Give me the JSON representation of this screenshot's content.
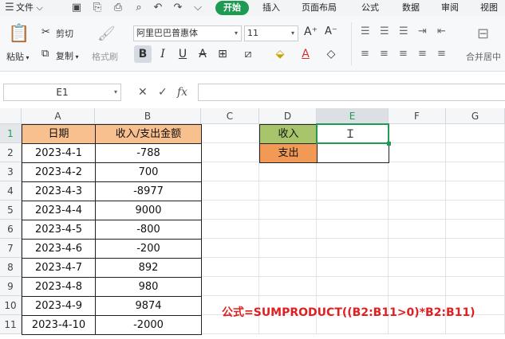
{
  "menubar": {
    "file_label": "文件",
    "tabs": [
      "开始",
      "插入",
      "页面布局",
      "公式",
      "数据",
      "审阅",
      "视图"
    ]
  },
  "ribbon": {
    "paste_label": "粘贴",
    "cut_label": "剪切",
    "copy_label": "复制",
    "format_painter_label": "格式刷",
    "font_name": "阿里巴巴普惠体",
    "font_size": "11",
    "merge_label": "合并居中"
  },
  "formula_bar": {
    "name_box": "E1",
    "formula": ""
  },
  "columns": [
    "A",
    "B",
    "C",
    "D",
    "E",
    "F",
    "G"
  ],
  "rows": [
    "1",
    "2",
    "3",
    "4",
    "5",
    "6",
    "7",
    "8",
    "9",
    "10",
    "11"
  ],
  "table": {
    "headers": [
      "日期",
      "收入/支出金额"
    ],
    "rows": [
      [
        "2023-4-1",
        "-788"
      ],
      [
        "2023-4-2",
        "700"
      ],
      [
        "2023-4-3",
        "-8977"
      ],
      [
        "2023-4-4",
        "9000"
      ],
      [
        "2023-4-5",
        "-800"
      ],
      [
        "2023-4-6",
        "-200"
      ],
      [
        "2023-4-7",
        "892"
      ],
      [
        "2023-4-8",
        "980"
      ],
      [
        "2023-4-9",
        "9874"
      ],
      [
        "2023-4-10",
        "-2000"
      ]
    ]
  },
  "summary": {
    "income_label": "收入",
    "expense_label": "支出"
  },
  "note": "公式=SUMPRODUCT((B2:B11>0)*B2:B11)",
  "colors": {
    "accent": "#1e9b53",
    "header_fill": "#f8c08f",
    "income_fill": "#a9c56b",
    "expense_fill": "#f29a55",
    "note_color": "#e02020"
  }
}
